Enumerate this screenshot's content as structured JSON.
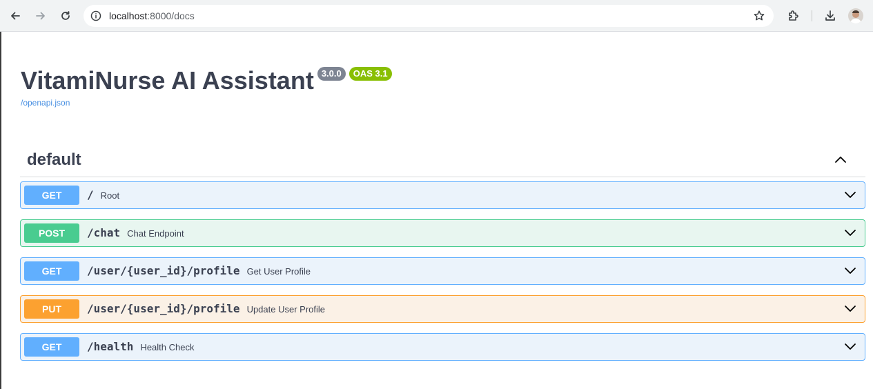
{
  "browser": {
    "url_host": "localhost",
    "url_rest": ":8000/docs"
  },
  "api": {
    "title": "VitamiNurse AI Assistant",
    "version": "3.0.0",
    "oas_version": "OAS 3.1",
    "spec_link": "/openapi.json"
  },
  "section": {
    "name": "default"
  },
  "operations": [
    {
      "method": "GET",
      "path": "/",
      "summary": "Root"
    },
    {
      "method": "POST",
      "path": "/chat",
      "summary": "Chat Endpoint"
    },
    {
      "method": "GET",
      "path": "/user/{user_id}/profile",
      "summary": "Get User Profile"
    },
    {
      "method": "PUT",
      "path": "/user/{user_id}/profile",
      "summary": "Update User Profile"
    },
    {
      "method": "GET",
      "path": "/health",
      "summary": "Health Check"
    }
  ],
  "colors": {
    "get": "#61affe",
    "post": "#49cc90",
    "put": "#fca130",
    "version_badge": "#7d8492",
    "oas_badge": "#89bf04",
    "title": "#3b4151"
  }
}
